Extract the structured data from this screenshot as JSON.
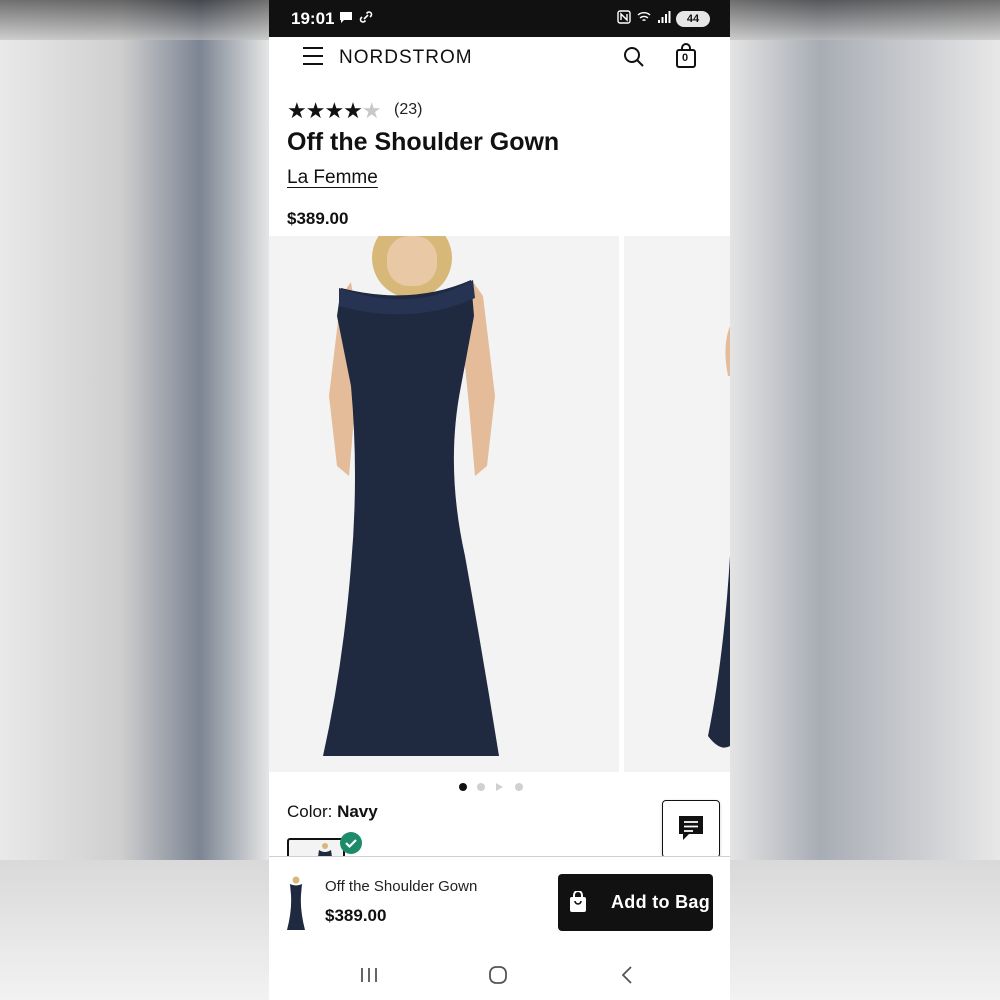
{
  "status_bar": {
    "time": "19:01",
    "battery": "44"
  },
  "header": {
    "brand": "NORDSTROM",
    "bag_count": "0"
  },
  "product": {
    "rating_stars": 4,
    "rating_count": "(23)",
    "title": "Off the Shoulder Gown",
    "brand": "La Femme",
    "price": "$389.00",
    "color_label": "Color: ",
    "color_value": "Navy",
    "gallery_current_page": 1,
    "gallery_pages": 4
  },
  "footer": {
    "product_name": "Off the Shoulder Gown",
    "product_price": "$389.00",
    "add_button": "Add to Bag"
  },
  "colors": {
    "accent_black": "#111111",
    "check_green": "#1d8a6a",
    "dress_navy": "#1f2940"
  },
  "icons": [
    "menu-icon",
    "search-icon",
    "bag-icon",
    "star-icon",
    "chat-icon",
    "check-icon",
    "recents-icon",
    "home-icon",
    "back-icon"
  ]
}
